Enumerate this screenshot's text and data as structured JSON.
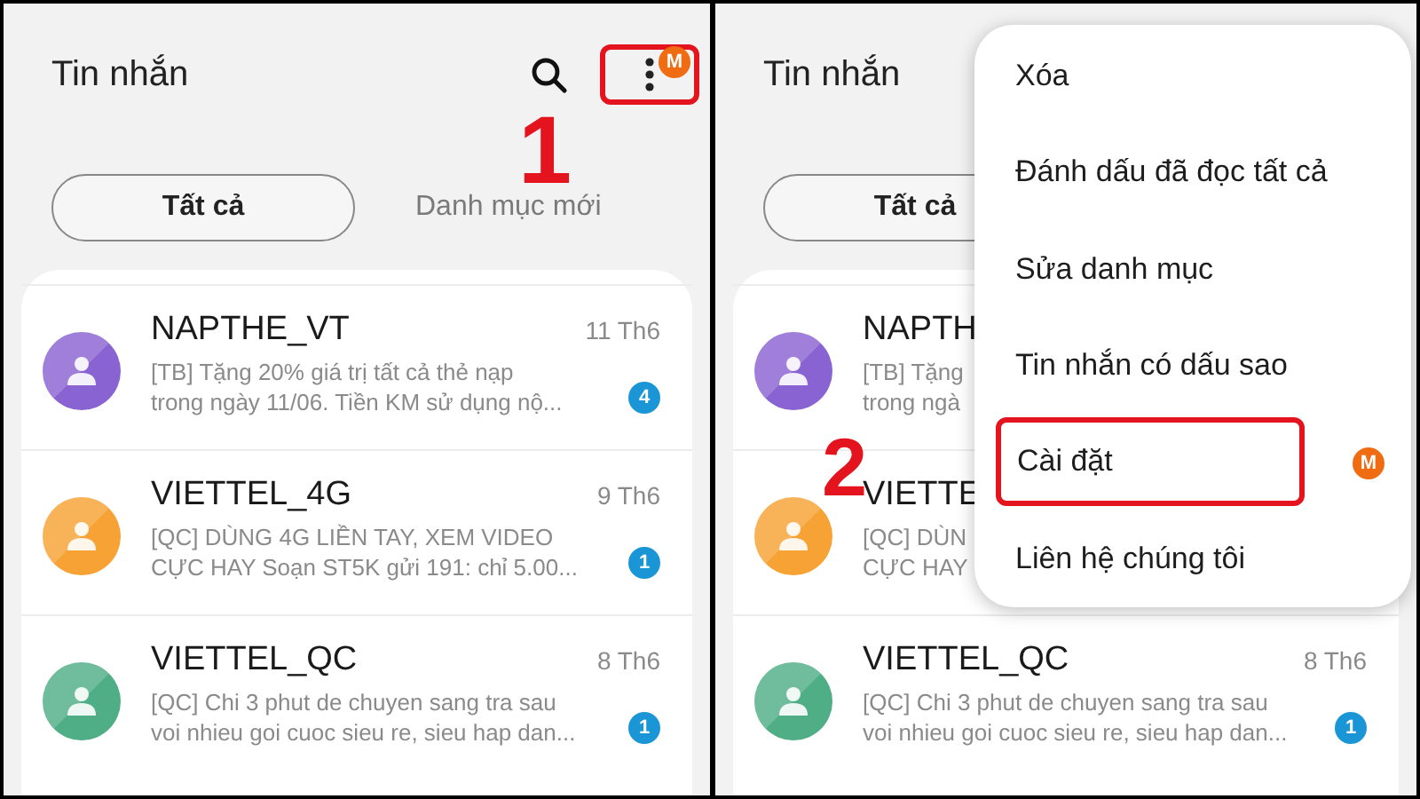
{
  "panels": [
    {
      "title": "Tin nhắn",
      "more_highlighted": true,
      "more_badge": "M",
      "step_label": "1",
      "tabs": [
        {
          "label": "Tất cả",
          "selected": true
        },
        {
          "label": "Danh mục mới",
          "selected": false
        }
      ],
      "conversations": [
        {
          "name": "NAPTHE_VT",
          "date": "11 Th6",
          "preview": [
            "[TB] Tặng 20% giá trị tất cả thẻ nạp",
            "trong ngày 11/06. Tiền KM sử dụng nộ..."
          ],
          "unread": "4",
          "color": "#8a63d2"
        },
        {
          "name": "VIETTEL_4G",
          "date": "9 Th6",
          "preview": [
            "[QC] DÙNG 4G LIỀN TAY, XEM VIDEO",
            "CỰC HAY Soạn ST5K gửi 191: chỉ 5.00..."
          ],
          "unread": "1",
          "color": "#f7a234"
        },
        {
          "name": "VIETTEL_QC",
          "date": "8 Th6",
          "preview": [
            "[QC] Chi 3 phut de chuyen sang tra sau",
            "voi nhieu goi cuoc sieu re, sieu hap dan..."
          ],
          "unread": "1",
          "color": "#4fae86"
        }
      ]
    },
    {
      "title": "Tin nhắn",
      "step_label": "2",
      "tabs": [
        {
          "label": "Tất cả",
          "selected": true
        }
      ],
      "conversations": [
        {
          "name": "NAPTH",
          "preview": [
            "[TB] Tặng",
            "trong ngà"
          ],
          "color": "#8a63d2"
        },
        {
          "name": "VIETTE",
          "preview": [
            "[QC] DÙN",
            "CỰC HAY"
          ],
          "color": "#f7a234"
        },
        {
          "name": "VIETTEL_QC",
          "date": "8 Th6",
          "preview": [
            "[QC] Chi 3 phut de chuyen sang tra sau",
            "voi nhieu goi cuoc sieu re, sieu hap dan..."
          ],
          "unread": "1",
          "color": "#4fae86"
        }
      ],
      "menu": {
        "items": [
          {
            "label": "Xóa",
            "highlighted": false
          },
          {
            "label": "Đánh dấu đã đọc tất cả",
            "highlighted": false
          },
          {
            "label": "Sửa danh mục",
            "highlighted": false
          },
          {
            "label": "Tin nhắn có dấu sao",
            "highlighted": false
          },
          {
            "label": "Cài đặt",
            "highlighted": true,
            "badge": "M"
          },
          {
            "label": "Liên hệ chúng tôi",
            "highlighted": false
          }
        ]
      }
    }
  ]
}
